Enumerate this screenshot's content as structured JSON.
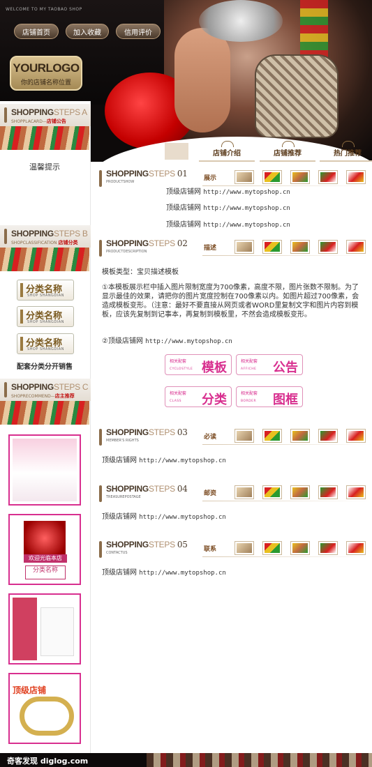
{
  "header": {
    "welcome_text": "WELCOME TO MY TAOBAO SHOP",
    "nav": [
      "店铺首页",
      "加入收藏",
      "信用评价"
    ],
    "logo": {
      "main": "YOURLOGO",
      "sub": "你的店铺名称位置"
    }
  },
  "sidebar": {
    "section_a": {
      "title_dark": "SHOPPING",
      "title_light": "STEPS A",
      "sub_en": "SHOPPLACARD",
      "sub_cn": "店铺公告"
    },
    "notice_text": "温馨提示",
    "section_b": {
      "title_dark": "SHOPPING",
      "title_light": "STEPS B",
      "sub_en": "SHOPCLASSIFICATION",
      "sub_cn": "店铺分类"
    },
    "categories": [
      {
        "label": "分类名称",
        "sub": "SHOP SHANGDIAN"
      },
      {
        "label": "分类名称",
        "sub": "SHOP SHANGDIAN"
      },
      {
        "label": "分类名称",
        "sub": "SHOP SHANGDIAN"
      }
    ],
    "category_caption": "配套分类分开销售",
    "section_c": {
      "title_dark": "SHOPPING",
      "title_light": "STEPS C",
      "sub_en": "SHOPRECOMMEND",
      "sub_cn": "店主推荐"
    },
    "thumb2": {
      "welcome": "欢迎光临本店",
      "cat": "分类名称"
    },
    "thumb4": {
      "shop": "顶级店铺"
    }
  },
  "top_tabs": [
    "店铺介绍",
    "店铺推荐",
    "热门推荐"
  ],
  "sections": [
    {
      "num": "01",
      "sub_en": "PRODUCTSHOW",
      "tag": "展示"
    },
    {
      "num": "02",
      "sub_en": "PRODUCTDESCRIPTION",
      "tag": "描述"
    },
    {
      "num": "03",
      "sub_en": "MEMBER'S RIGHTS",
      "tag": "必读"
    },
    {
      "num": "04",
      "sub_en": "TREASUREPOSTAGE",
      "tag": "邮资"
    },
    {
      "num": "05",
      "sub_en": "CONTACTUS",
      "tag": "联系"
    }
  ],
  "section_title": {
    "dark": "SHOPPING",
    "light": "STEPS"
  },
  "links": {
    "name": "顶级店铺网",
    "url": "http://www.mytopshop.cn"
  },
  "description": {
    "type_line": "模板类型：宝贝描述模板",
    "para1": "①本模板展示栏中插入图片限制宽度为700像素，高度不限，图片张数不限制。为了显示最佳的效果，请把你的图片宽度控制在700像素以内。如图片超过700像素，会造成模板变形。（注意：最好不要直接从网页或者WORD里复制文字和图片内容到模板，应该先复制到记事本，再复制到模板里，不然会造成模板变形。",
    "para2_prefix": "②顶级店铺网"
  },
  "pink_buttons": [
    {
      "small": "相关配套",
      "en": "CYCLOSTYLE",
      "big": "模板"
    },
    {
      "small": "相关配套",
      "en": "AFFICHE",
      "big": "公告"
    },
    {
      "small": "相关配套",
      "en": "CLASS",
      "big": "分类"
    },
    {
      "small": "相关配套",
      "en": "BORDER",
      "big": "图框"
    }
  ],
  "footer": {
    "watermark": "奇客发现 diglog.com"
  }
}
